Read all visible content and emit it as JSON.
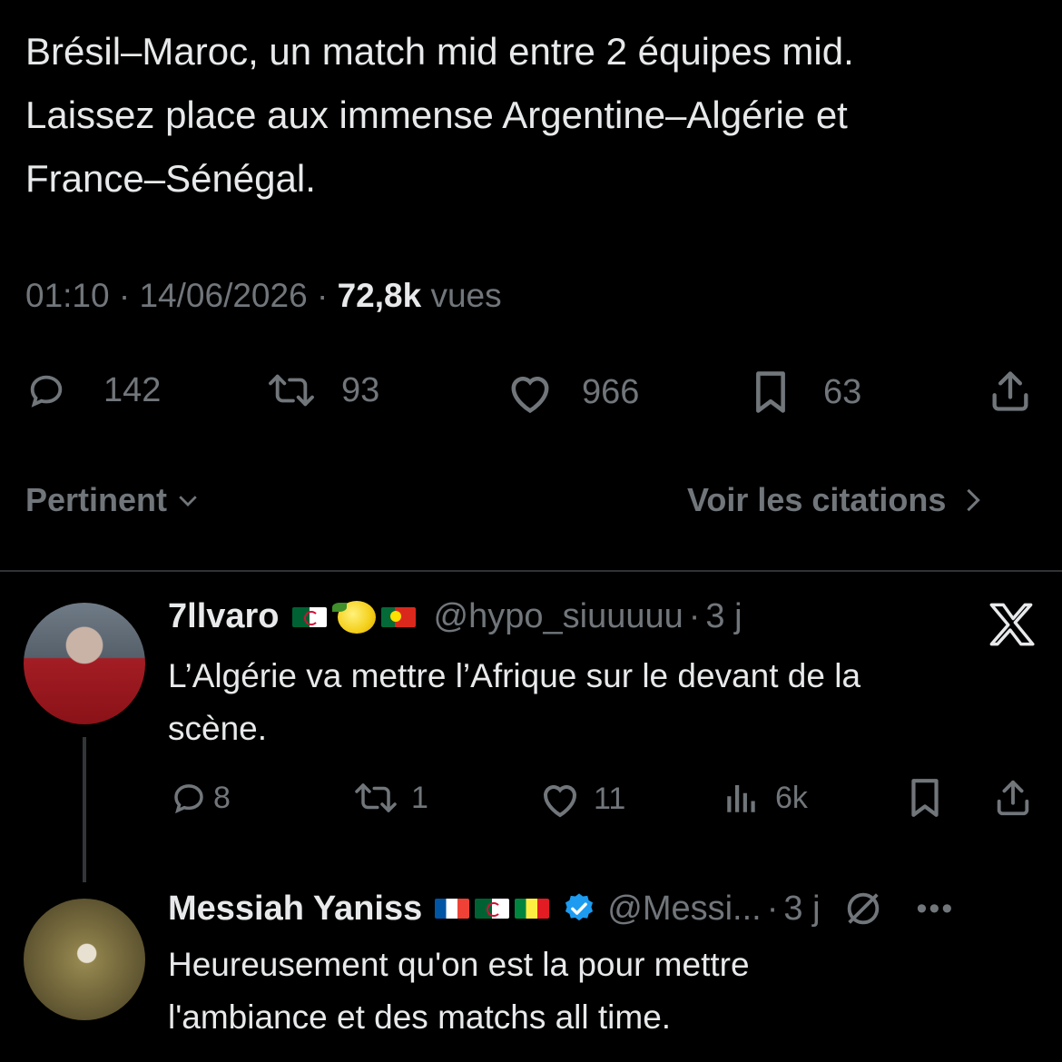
{
  "tweet": {
    "text_lines": [
      "Brésil–Maroc, un match mid entre 2 équipes mid.",
      "Laissez place aux immense Argentine–Algérie et",
      "France–Sénégal."
    ],
    "time": "01:10",
    "sep1": "·",
    "date": "14/06/2026",
    "sep2": "·",
    "views_count": "72,8k",
    "views_label": "vues",
    "replies": "142",
    "retweets": "93",
    "likes": "966",
    "bookmarks": "63"
  },
  "sort": {
    "label": "Pertinent",
    "quotes_link": "Voir les citations"
  },
  "replies": [
    {
      "name": "7llvaro",
      "handle": "@hypo_siuuuuu",
      "sep": "·",
      "time": "3 j",
      "text_lines": [
        "L’Algérie va mettre l’Afrique sur le devant de la",
        "scène."
      ],
      "stats": {
        "replies": "8",
        "retweets": "1",
        "likes": "11",
        "views": "6k"
      }
    },
    {
      "name": "Messiah Yaniss",
      "handle": "@Messi...",
      "sep": "·",
      "time": "3 j",
      "text_lines": [
        "Heureusement qu'on est la pour mettre",
        "l'ambiance et des matchs all time."
      ]
    }
  ],
  "colors": {
    "background": "#000000",
    "text": "#e7e9ea",
    "muted": "#71767b",
    "divider": "#2f3336",
    "verified": "#1d9bf0"
  },
  "icons": [
    "reply-icon",
    "retweet-icon",
    "like-icon",
    "bookmark-icon",
    "share-icon",
    "chevron-down-icon",
    "chevron-right-icon",
    "x-logo-icon",
    "views-icon",
    "verified-badge-icon",
    "grok-icon",
    "more-icon"
  ]
}
